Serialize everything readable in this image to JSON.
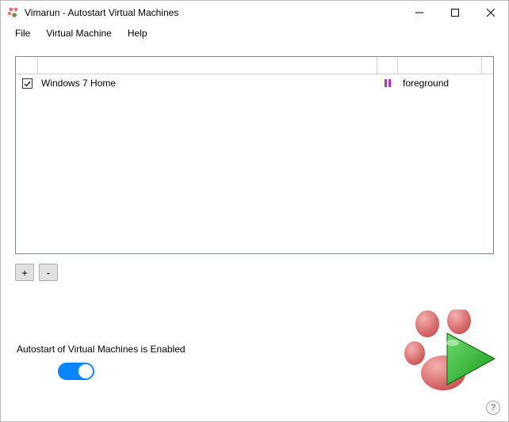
{
  "window": {
    "title": "Vimarun - Autostart Virtual Machines"
  },
  "menu": {
    "file": "File",
    "vm": "Virtual Machine",
    "help": "Help"
  },
  "rows": [
    {
      "checked": true,
      "name": "Windows 7 Home",
      "state_icon": "pause",
      "mode": "foreground"
    }
  ],
  "buttons": {
    "add": "+",
    "remove": "-"
  },
  "autostart": {
    "label": "Autostart of Virtual Machines is Enabled",
    "enabled": true
  },
  "help": {
    "glyph": "?"
  }
}
